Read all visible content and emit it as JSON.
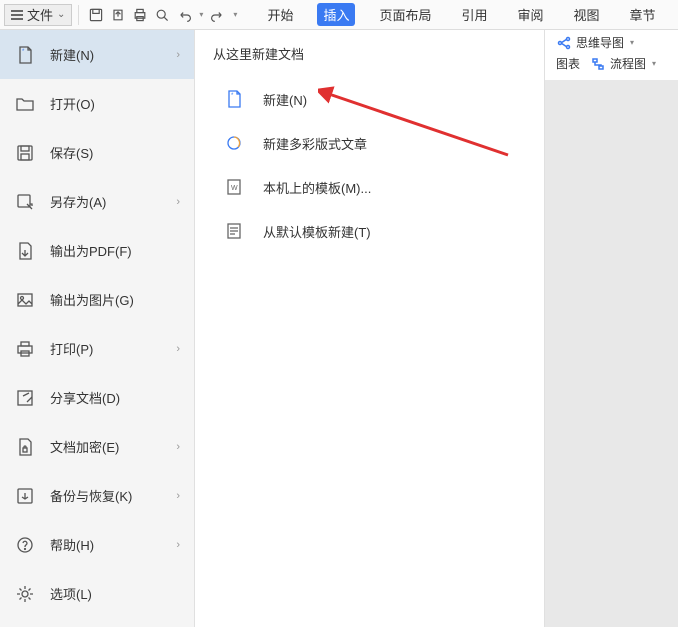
{
  "toolbar": {
    "file_label": "文件"
  },
  "tabs": {
    "start": "开始",
    "insert": "插入",
    "layout": "页面布局",
    "reference": "引用",
    "review": "审阅",
    "view": "视图",
    "chapter": "章节"
  },
  "ribbon": {
    "mindmap": "思维导图",
    "chart": "图表",
    "flowchart": "流程图"
  },
  "menu": {
    "new": "新建(N)",
    "open": "打开(O)",
    "save": "保存(S)",
    "save_as": "另存为(A)",
    "export_pdf": "输出为PDF(F)",
    "export_image": "输出为图片(G)",
    "print": "打印(P)",
    "share": "分享文档(D)",
    "encrypt": "文档加密(E)",
    "backup": "备份与恢复(K)",
    "help": "帮助(H)",
    "options": "选项(L)"
  },
  "submenu": {
    "title": "从这里新建文档",
    "new_blank": "新建(N)",
    "new_color": "新建多彩版式文章",
    "local_template": "本机上的模板(M)...",
    "default_template": "从默认模板新建(T)"
  }
}
